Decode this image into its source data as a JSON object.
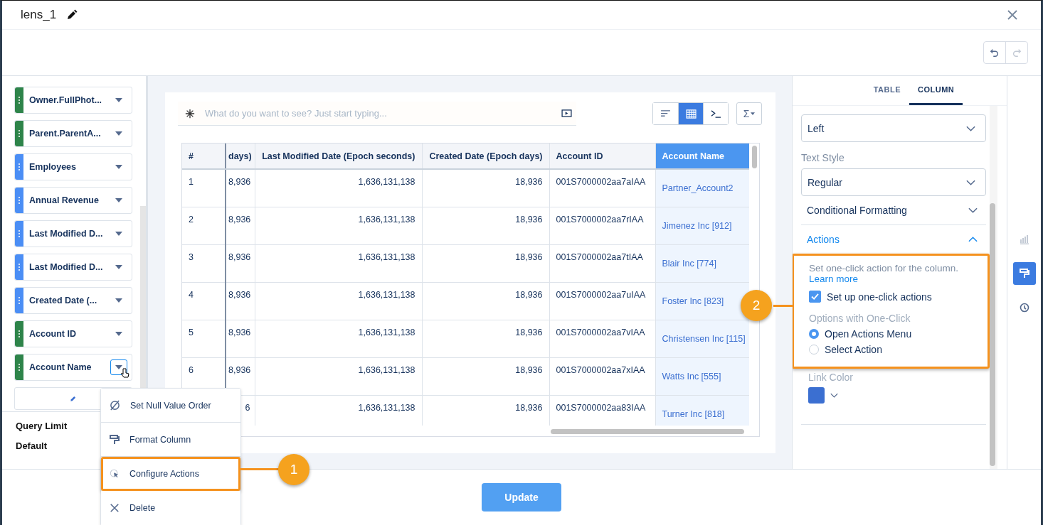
{
  "title": "lens_1",
  "fields": [
    {
      "label": "Owner.FullPhot...",
      "kind": "dimension",
      "hovered": false
    },
    {
      "label": "Parent.ParentA...",
      "kind": "dimension",
      "hovered": false
    },
    {
      "label": "Employees",
      "kind": "measure",
      "hovered": false
    },
    {
      "label": "Annual Revenue",
      "kind": "measure",
      "hovered": false
    },
    {
      "label": "Last Modified D...",
      "kind": "measure",
      "hovered": false
    },
    {
      "label": "Last Modified D...",
      "kind": "measure",
      "hovered": false
    },
    {
      "label": "Created Date (...",
      "kind": "measure",
      "hovered": false
    },
    {
      "label": "Account ID",
      "kind": "dimension",
      "hovered": false
    },
    {
      "label": "Account Name",
      "kind": "dimension",
      "hovered": true
    }
  ],
  "settings": [
    "Query Limit",
    "Default"
  ],
  "search": {
    "placeholder": "What do you want to see? Just start typing..."
  },
  "view_buttons": [
    {
      "kind": "lines",
      "selected": false
    },
    {
      "kind": "grid",
      "selected": true
    },
    {
      "kind": "console",
      "selected": false
    }
  ],
  "summary_button": "Σ",
  "table": {
    "columns": [
      {
        "label": "#",
        "kind": "text",
        "selected": false
      },
      {
        "label": "days)",
        "kind": "number",
        "selected": false
      },
      {
        "label": "Last Modified Date (Epoch seconds)",
        "kind": "number",
        "selected": false
      },
      {
        "label": "Created Date (Epoch days)",
        "kind": "number",
        "selected": false
      },
      {
        "label": "Account ID",
        "kind": "text",
        "selected": false
      },
      {
        "label": "Account Name",
        "kind": "text",
        "selected": true
      }
    ],
    "rows": [
      [
        "1",
        "8,936",
        "1,636,131,138",
        "18,936",
        "001S7000002aa7aIAA",
        "Partner_Account2"
      ],
      [
        "2",
        "8,936",
        "1,636,131,138",
        "18,936",
        "001S7000002aa7rIAA",
        "Jimenez Inc [912]"
      ],
      [
        "3",
        "8,936",
        "1,636,131,138",
        "18,936",
        "001S7000002aa7tIAA",
        "Blair Inc [774]"
      ],
      [
        "4",
        "8,936",
        "1,636,131,138",
        "18,936",
        "001S7000002aa7uIAA",
        "Foster Inc [823]"
      ],
      [
        "5",
        "8,936",
        "1,636,131,138",
        "18,936",
        "001S7000002aa7vIAA",
        "Christensen Inc [115]"
      ],
      [
        "6",
        "8,936",
        "1,636,131,138",
        "18,936",
        "001S7000002aa7xIAA",
        "Watts Inc [555]"
      ],
      [
        "",
        "6",
        "1,636,131,138",
        "18,936",
        "001S7000002aa83IAA",
        "Turner Inc [818]"
      ]
    ]
  },
  "menu": [
    {
      "label": "Set Null Value Order",
      "kind": "null_order",
      "highlighted": false
    },
    {
      "label": "Format Column",
      "kind": "format",
      "highlighted": false
    },
    {
      "label": "Configure Actions",
      "kind": "actions",
      "highlighted": true
    },
    {
      "label": "Delete",
      "kind": "delete",
      "highlighted": false
    }
  ],
  "panel": {
    "tabs": [
      {
        "label": "TABLE",
        "selected": false
      },
      {
        "label": "COLUMN",
        "selected": true
      }
    ],
    "alignment_value": "Left",
    "text_style_label": "Text Style",
    "text_style_value": "Regular",
    "sections": [
      {
        "label": "Conditional Formatting",
        "expanded": false
      },
      {
        "label": "Actions",
        "expanded": true
      }
    ],
    "actions": {
      "highlighted": true,
      "description": "Set one-click action for the column.",
      "learn_more": "Learn more",
      "checkbox": {
        "label": "Set up one-click actions",
        "checked": true
      },
      "options_label": "Options with One-Click",
      "options": [
        {
          "label": "Open Actions Menu",
          "selected": true
        },
        {
          "label": "Select Action",
          "selected": false
        }
      ]
    },
    "link_color_label": "Link Color",
    "link_color": {
      "color": "#3b6fd1"
    }
  },
  "rail": [
    {
      "kind": "chart",
      "selected": false
    },
    {
      "kind": "paint",
      "selected": true
    },
    {
      "kind": "clock",
      "selected": false
    }
  ],
  "callouts": [
    {
      "number": "1"
    },
    {
      "number": "2"
    }
  ],
  "update_button": "Update"
}
